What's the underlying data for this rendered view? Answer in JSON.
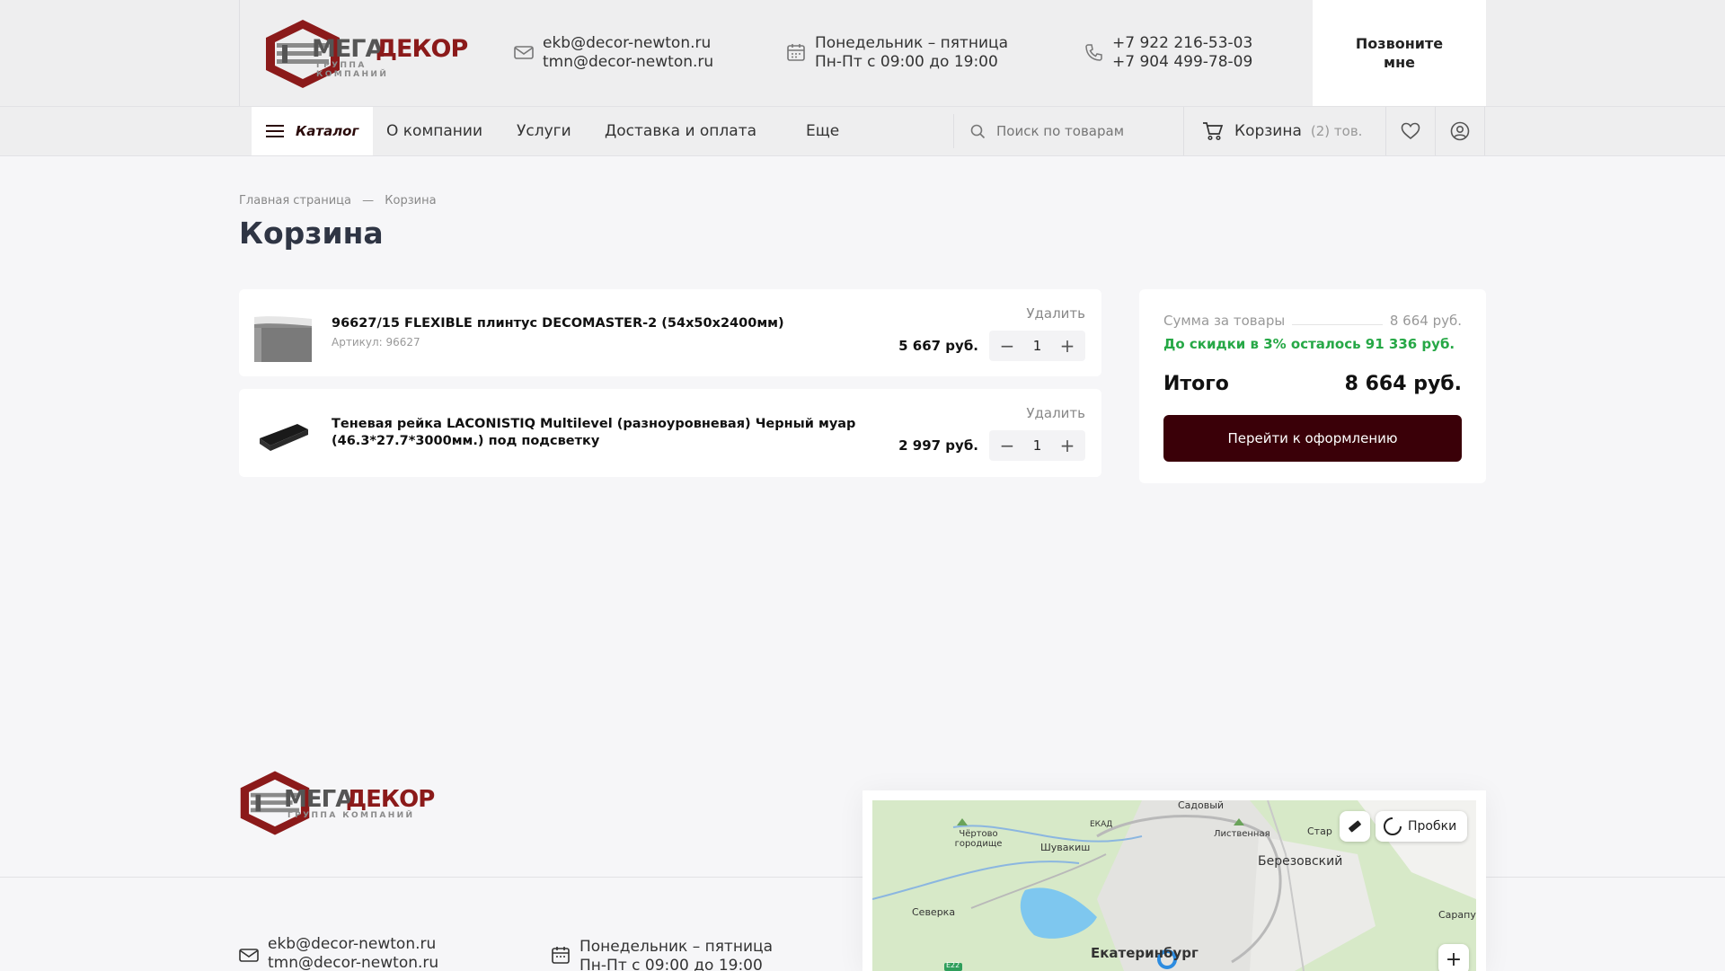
{
  "header": {
    "logo": {
      "word_1": "МЕГА",
      "word_2": "ДЕКОР",
      "subtitle": "ГРУППА КОМПАНИЙ"
    },
    "emails": [
      "ekb@decor-newton.ru",
      "tmn@decor-newton.ru"
    ],
    "schedule": [
      "Понедельник – пятница",
      "Пн-Пт с 09:00 до 19:00"
    ],
    "phones": [
      "+7 922 216-53-03",
      "+7 904 499-78-09"
    ],
    "callback_label": "Позвоните мне"
  },
  "nav": {
    "catalog_label": "Каталог",
    "items": [
      "О компании",
      "Услуги",
      "Доставка и оплата",
      "Еще"
    ],
    "search_placeholder": "Поиск по товарам",
    "cart_label": "Корзина",
    "cart_count": "(2) тов."
  },
  "breadcrumb": {
    "home": "Главная страница",
    "separator": "—",
    "current": "Корзина"
  },
  "page_title": "Корзина",
  "cart_items": [
    {
      "name": "96627/15 FLEXIBLE плинтус DECOMASTER-2 (54x50x2400мм)",
      "sku": "Артикул: 96627",
      "price": "5 667 руб.",
      "qty": "1",
      "delete_label": "Удалить"
    },
    {
      "name": "Теневая рейка LACONISTIQ Multilevel (разноуровневая) Черный муар (46.3*27.7*3000мм.) под подсветку",
      "sku": "",
      "price": "2 997 руб.",
      "qty": "1",
      "delete_label": "Удалить"
    }
  ],
  "summary": {
    "goods_label": "Сумма за товары",
    "goods_value": "8 664 руб.",
    "discount_note": "До скидки в 3% осталось 91 336 руб.",
    "total_label": "Итого",
    "total_value": "8 664 руб.",
    "checkout_label": "Перейти к оформлению"
  },
  "footer": {
    "emails": [
      "ekb@decor-newton.ru",
      "tmn@decor-newton.ru"
    ],
    "schedule": [
      "Понедельник – пятница",
      "Пн-Пт с 09:00 до 19:00"
    ]
  },
  "map": {
    "traffic_label": "Пробки",
    "zoom_in": "+",
    "places": [
      "Садовый",
      "Чёртово городище",
      "Шувакиш",
      "Лиственная",
      "Березовский",
      "Северка",
      "Екатеринбург",
      "Сарапулка",
      "ЕКАД",
      "Стар",
      "E22"
    ]
  },
  "colors": {
    "brand_red": "#8b1a1a",
    "button_dark": "#3a0008",
    "accent_green": "#26a846",
    "heading": "#2f3544"
  }
}
